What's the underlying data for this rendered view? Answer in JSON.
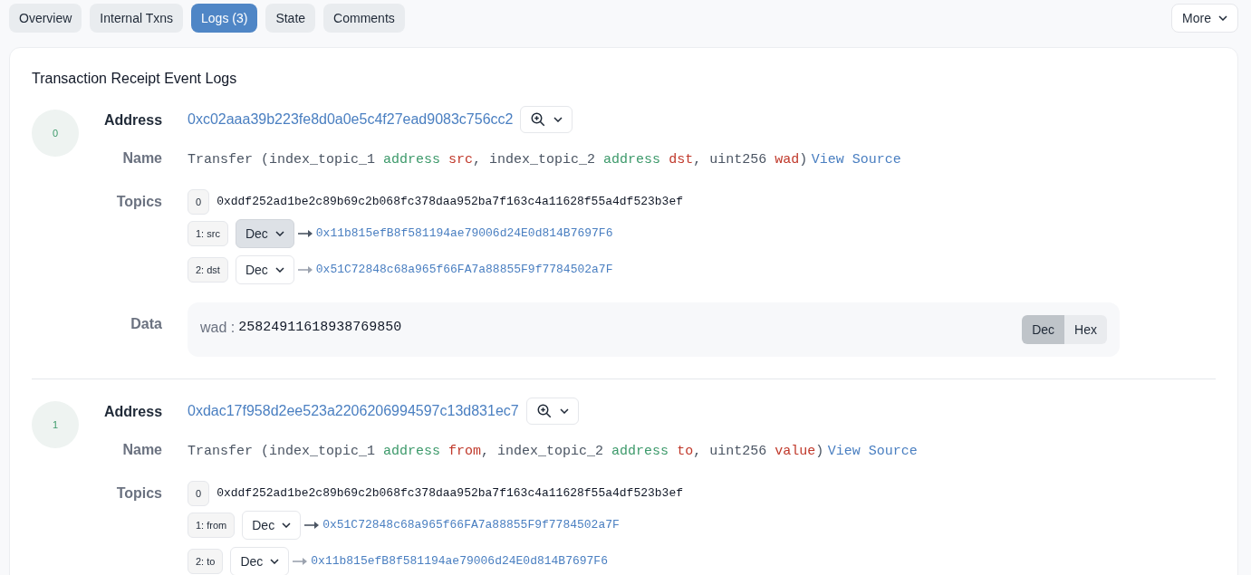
{
  "tabs": [
    {
      "label": "Overview",
      "selected": false
    },
    {
      "label": "Internal Txns",
      "selected": false
    },
    {
      "label": "Logs (3)",
      "selected": true
    },
    {
      "label": "State",
      "selected": false
    },
    {
      "label": "Comments",
      "selected": false
    }
  ],
  "more_button": "More",
  "title": "Transaction Receipt Event Logs",
  "logs": [
    {
      "index": "0",
      "address_label": "Address",
      "address": "0xc02aaa39b223fe8d0a0e5c4f27ead9083c756cc2",
      "name_label": "Name",
      "name": [
        {
          "kind": "plain",
          "text": "Transfer (index_topic_1 "
        },
        {
          "kind": "type",
          "text": "address "
        },
        {
          "kind": "param",
          "text": "src"
        },
        {
          "kind": "plain",
          "text": ", index_topic_2 "
        },
        {
          "kind": "type",
          "text": "address "
        },
        {
          "kind": "param",
          "text": "dst"
        },
        {
          "kind": "plain",
          "text": ", uint256 "
        },
        {
          "kind": "param",
          "text": "wad"
        },
        {
          "kind": "plain",
          "text": ")"
        }
      ],
      "view_source": "View Source",
      "topics_label": "Topics",
      "topics": [
        {
          "kind": "raw",
          "tag": "0",
          "value": "0xddf252ad1be2c89b69c2b068fc378daa952ba7f163c4a11628f55a4df523b3ef"
        },
        {
          "kind": "decoded",
          "tag": "1: src",
          "format": "Dec",
          "highlighted": true,
          "value": "0x11b815efB8f581194ae79006d24E0d814B7697F6"
        },
        {
          "kind": "decoded",
          "tag": "2: dst",
          "format": "Dec",
          "highlighted": false,
          "value": "0x51C72848c68a965f66FA7a88855F9f7784502a7F"
        }
      ],
      "data_label": "Data",
      "data": {
        "key": "wad :",
        "value": "25824911618938769850",
        "formats": [
          {
            "label": "Dec",
            "selected": true
          },
          {
            "label": "Hex",
            "selected": false
          }
        ]
      }
    },
    {
      "index": "1",
      "address_label": "Address",
      "address": "0xdac17f958d2ee523a2206206994597c13d831ec7",
      "name_label": "Name",
      "name": [
        {
          "kind": "plain",
          "text": "Transfer (index_topic_1 "
        },
        {
          "kind": "type",
          "text": "address "
        },
        {
          "kind": "param",
          "text": "from"
        },
        {
          "kind": "plain",
          "text": ", index_topic_2 "
        },
        {
          "kind": "type",
          "text": "address "
        },
        {
          "kind": "param",
          "text": "to"
        },
        {
          "kind": "plain",
          "text": ", uint256 "
        },
        {
          "kind": "param",
          "text": "value"
        },
        {
          "kind": "plain",
          "text": ")"
        }
      ],
      "view_source": "View Source",
      "topics_label": "Topics",
      "topics": [
        {
          "kind": "raw",
          "tag": "0",
          "value": "0xddf252ad1be2c89b69c2b068fc378daa952ba7f163c4a11628f55a4df523b3ef"
        },
        {
          "kind": "decoded",
          "tag": "1: from",
          "format": "Dec",
          "highlighted": false,
          "value": "0x51C72848c68a965f66FA7a88855F9f7784502a7F"
        },
        {
          "kind": "decoded",
          "tag": "2: to",
          "format": "Dec",
          "highlighted": false,
          "value": "0x11b815efB8f581194ae79006d24E0d814B7697F6"
        }
      ]
    }
  ]
}
